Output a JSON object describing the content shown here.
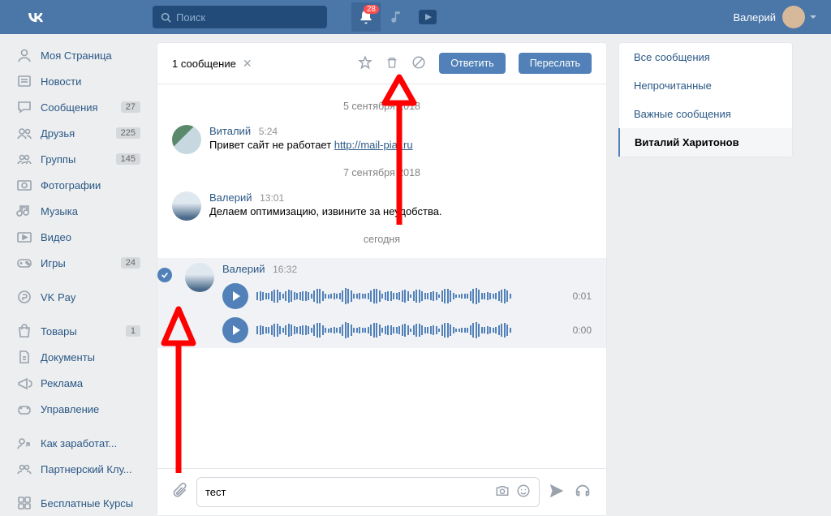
{
  "header": {
    "search_placeholder": "Поиск",
    "notif_count": "28",
    "username": "Валерий"
  },
  "left_nav": [
    {
      "icon": "profile",
      "label": "Моя Страница",
      "badge": ""
    },
    {
      "icon": "news",
      "label": "Новости",
      "badge": ""
    },
    {
      "icon": "messages",
      "label": "Сообщения",
      "badge": "27"
    },
    {
      "icon": "friends",
      "label": "Друзья",
      "badge": "225"
    },
    {
      "icon": "groups",
      "label": "Группы",
      "badge": "145"
    },
    {
      "icon": "photos",
      "label": "Фотографии",
      "badge": ""
    },
    {
      "icon": "music",
      "label": "Музыка",
      "badge": ""
    },
    {
      "icon": "video",
      "label": "Видео",
      "badge": ""
    },
    {
      "icon": "games",
      "label": "Игры",
      "badge": "24"
    },
    {
      "sep": true
    },
    {
      "icon": "vkpay",
      "label": "VK Pay",
      "badge": ""
    },
    {
      "sep": true
    },
    {
      "icon": "market",
      "label": "Товары",
      "badge": "1"
    },
    {
      "icon": "docs",
      "label": "Документы",
      "badge": ""
    },
    {
      "icon": "ads",
      "label": "Реклама",
      "badge": ""
    },
    {
      "icon": "manage",
      "label": "Управление",
      "badge": ""
    },
    {
      "sep": true
    },
    {
      "icon": "money",
      "label": "Как заработат...",
      "badge": ""
    },
    {
      "icon": "partner",
      "label": "Партнерский Клу...",
      "badge": ""
    },
    {
      "sep": true
    },
    {
      "icon": "apps",
      "label": "Бесплатные Курсы",
      "badge": ""
    }
  ],
  "msg_header": {
    "title": "1 сообщение",
    "reply": "Ответить",
    "forward": "Переслать"
  },
  "dates": {
    "d1": "5 сентября 2018",
    "d2": "7 сентября 2018",
    "d3": "сегодня"
  },
  "m1": {
    "author": "Виталий",
    "time": "5:24",
    "text": "Привет сайт не работает ",
    "link": "http://mail-piar.ru"
  },
  "m2": {
    "author": "Валерий",
    "time": "13:01",
    "text": "Делаем оптимизацию, извините за неудобства."
  },
  "m3": {
    "author": "Валерий",
    "time": "16:32",
    "dur1": "0:01",
    "dur2": "0:00"
  },
  "input": {
    "value": "тест"
  },
  "filters": {
    "all": "Все сообщения",
    "unread": "Непрочитанные",
    "important": "Важные сообщения",
    "active": "Виталий Харитонов"
  }
}
